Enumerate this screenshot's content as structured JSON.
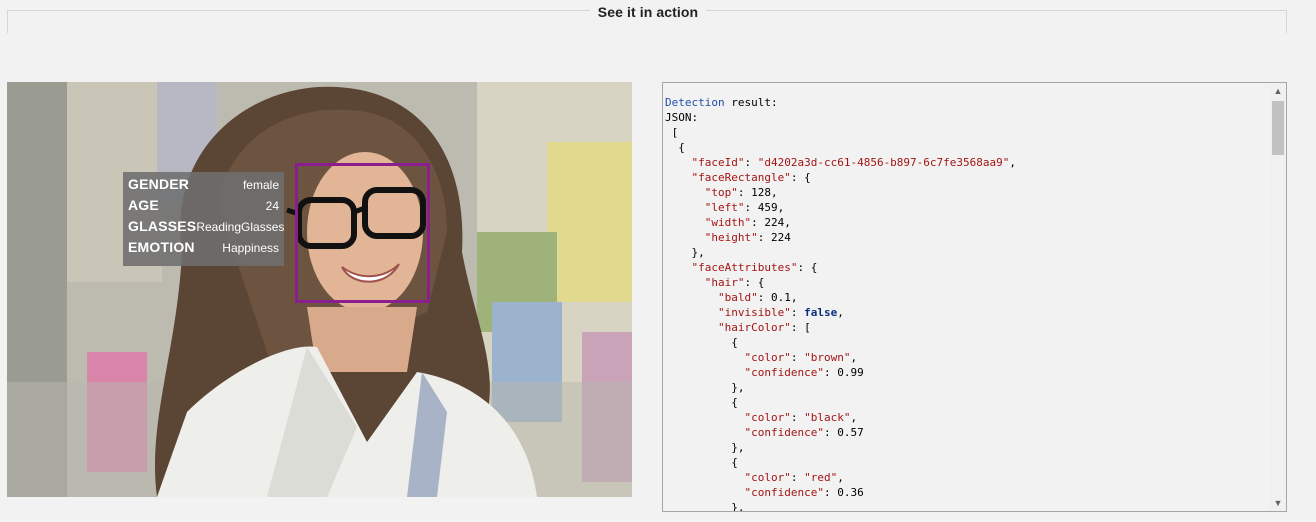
{
  "section": {
    "title": "See it in action"
  },
  "face_attributes": [
    {
      "key": "GENDER",
      "value": "female"
    },
    {
      "key": "AGE",
      "value": "24"
    },
    {
      "key": "GLASSES",
      "value": "ReadingGlasses"
    },
    {
      "key": "EMOTION",
      "value": "Happiness"
    }
  ],
  "result": {
    "heading_word": "Detection",
    "heading_rest": " result:",
    "json_label": "JSON:",
    "lines": [
      {
        "text": " ["
      },
      {
        "text": "  {"
      },
      {
        "pre": "    ",
        "key": "\"faceId\"",
        "sep": ": ",
        "val": "\"d4202a3d-cc61-4856-b897-6c7fe3568aa9\"",
        "vtype": "str",
        "post": ","
      },
      {
        "pre": "    ",
        "key": "\"faceRectangle\"",
        "sep": ": {"
      },
      {
        "pre": "      ",
        "key": "\"top\"",
        "sep": ": ",
        "val": "128",
        "vtype": "num",
        "post": ","
      },
      {
        "pre": "      ",
        "key": "\"left\"",
        "sep": ": ",
        "val": "459",
        "vtype": "num",
        "post": ","
      },
      {
        "pre": "      ",
        "key": "\"width\"",
        "sep": ": ",
        "val": "224",
        "vtype": "num",
        "post": ","
      },
      {
        "pre": "      ",
        "key": "\"height\"",
        "sep": ": ",
        "val": "224",
        "vtype": "num"
      },
      {
        "text": "    },"
      },
      {
        "pre": "    ",
        "key": "\"faceAttributes\"",
        "sep": ": {"
      },
      {
        "pre": "      ",
        "key": "\"hair\"",
        "sep": ": {"
      },
      {
        "pre": "        ",
        "key": "\"bald\"",
        "sep": ": ",
        "val": "0.1",
        "vtype": "num",
        "post": ","
      },
      {
        "pre": "        ",
        "key": "\"invisible\"",
        "sep": ": ",
        "val": "false",
        "vtype": "bool",
        "post": ","
      },
      {
        "pre": "        ",
        "key": "\"hairColor\"",
        "sep": ": ["
      },
      {
        "text": "          {"
      },
      {
        "pre": "            ",
        "key": "\"color\"",
        "sep": ": ",
        "val": "\"brown\"",
        "vtype": "str",
        "post": ","
      },
      {
        "pre": "            ",
        "key": "\"confidence\"",
        "sep": ": ",
        "val": "0.99",
        "vtype": "num"
      },
      {
        "text": "          },"
      },
      {
        "text": "          {"
      },
      {
        "pre": "            ",
        "key": "\"color\"",
        "sep": ": ",
        "val": "\"black\"",
        "vtype": "str",
        "post": ","
      },
      {
        "pre": "            ",
        "key": "\"confidence\"",
        "sep": ": ",
        "val": "0.57",
        "vtype": "num"
      },
      {
        "text": "          },"
      },
      {
        "text": "          {"
      },
      {
        "pre": "            ",
        "key": "\"color\"",
        "sep": ": ",
        "val": "\"red\"",
        "vtype": "str",
        "post": ","
      },
      {
        "pre": "            ",
        "key": "\"confidence\"",
        "sep": ": ",
        "val": "0.36",
        "vtype": "num"
      },
      {
        "text": "          },"
      }
    ]
  },
  "colors": {
    "face_box": "#8b1d8f",
    "json_key": "#a31515",
    "json_keyword": "#1f4fa8"
  }
}
